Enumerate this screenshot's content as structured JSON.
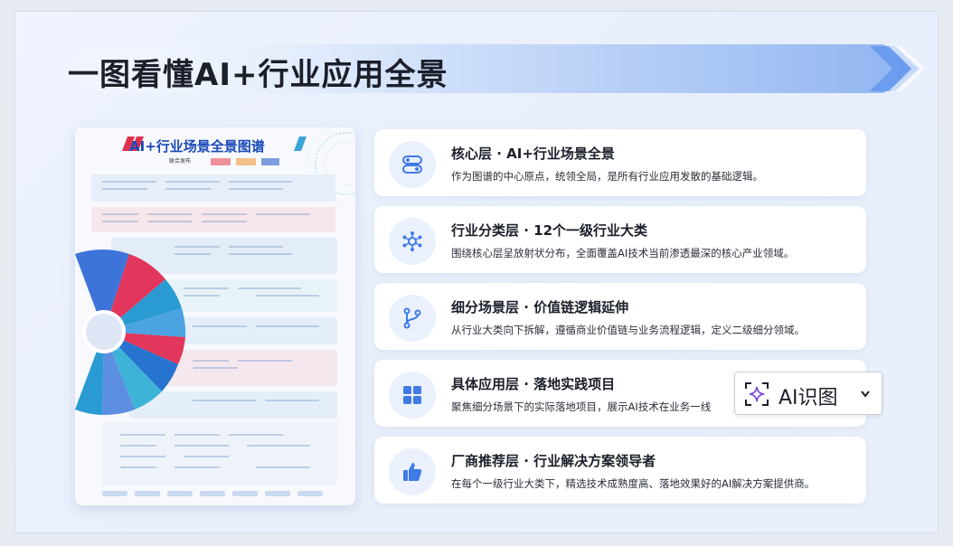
{
  "slide": {
    "title": "一图看懂AI+行业应用全景"
  },
  "poster": {
    "title": "AI+行业场景全景图谱",
    "tag": "联合发布"
  },
  "cards": [
    {
      "icon": "toggle-icon",
      "title": "核心层 · AI+行业场景全景",
      "desc": "作为图谱的中心原点，统领全局，是所有行业应用发散的基础逻辑。"
    },
    {
      "icon": "hub-network-icon",
      "title": "行业分类层 · 12个一级行业大类",
      "desc": "围绕核心层呈放射状分布，全面覆盖AI技术当前渗透最深的核心产业领域。"
    },
    {
      "icon": "branch-icon",
      "title": "细分场景层 · 价值链逻辑延伸",
      "desc": "从行业大类向下拆解，遵循商业价值链与业务流程逻辑，定义二级细分领域。"
    },
    {
      "icon": "grid-icon",
      "title": "具体应用层 · 落地实践项目",
      "desc": "聚焦细分场景下的实际落地项目，展示AI技术在业务一线"
    },
    {
      "icon": "thumbs-up-icon",
      "title": "厂商推荐层 · 行业解决方案领导者",
      "desc": "在每个一级行业大类下，精选技术成熟度高、落地效果好的AI解决方案提供商。"
    }
  ],
  "ai_tool": {
    "label": "AI识图"
  },
  "colors": {
    "accent": "#3f7ae6",
    "icon_bg": "#eaf1fd",
    "text": "#1b1f2a"
  }
}
